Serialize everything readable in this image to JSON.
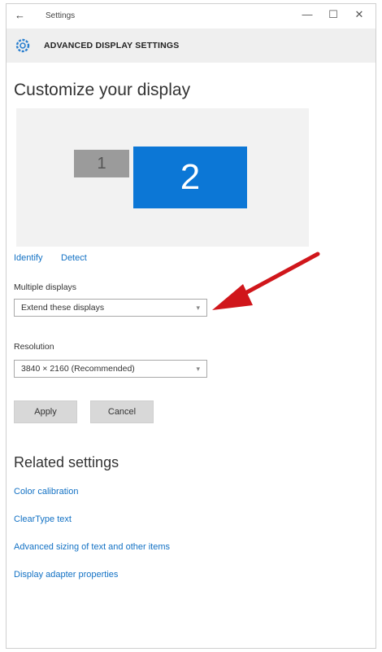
{
  "titlebar": {
    "back_glyph": "←",
    "title": "Settings",
    "minimize_glyph": "—",
    "maximize_glyph": "☐",
    "close_glyph": "✕"
  },
  "header": {
    "icon": "gear-icon",
    "title": "ADVANCED DISPLAY SETTINGS"
  },
  "main": {
    "heading": "Customize your display",
    "monitors": [
      {
        "number": "1",
        "color": "#9b9b9b"
      },
      {
        "number": "2",
        "color": "#0c77d6",
        "selected": true
      }
    ],
    "identify_link": "Identify",
    "detect_link": "Detect",
    "multiple_displays_label": "Multiple displays",
    "multiple_displays_value": "Extend these displays",
    "resolution_label": "Resolution",
    "resolution_value": "3840 × 2160 (Recommended)",
    "apply_button": "Apply",
    "cancel_button": "Cancel"
  },
  "related": {
    "heading": "Related settings",
    "links": [
      "Color calibration",
      "ClearType text",
      "Advanced sizing of text and other items",
      "Display adapter properties"
    ]
  },
  "annotation": {
    "arrow_color": "#d0161b"
  }
}
